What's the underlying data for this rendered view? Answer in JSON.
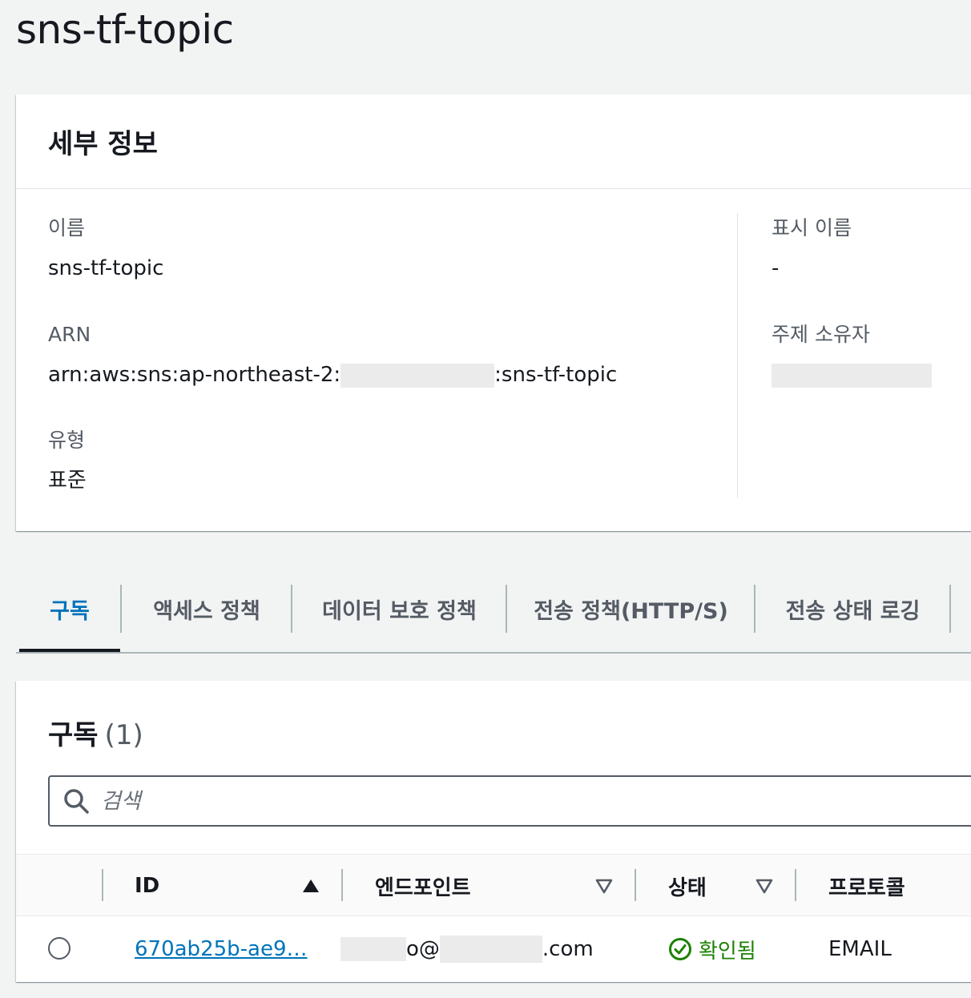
{
  "page": {
    "title": "sns-tf-topic"
  },
  "details": {
    "section_title": "세부 정보",
    "name_label": "이름",
    "name_value": "sns-tf-topic",
    "arn_label": "ARN",
    "arn_prefix": "arn:aws:sns:ap-northeast-2:",
    "arn_suffix": ":sns-tf-topic",
    "type_label": "유형",
    "type_value": "표준",
    "display_name_label": "표시 이름",
    "display_name_value": "-",
    "owner_label": "주제 소유자"
  },
  "tabs": [
    {
      "label": "구독",
      "active": true
    },
    {
      "label": "액세스 정책",
      "active": false
    },
    {
      "label": "데이터 보호 정책",
      "active": false
    },
    {
      "label": "전송 정책(HTTP/S)",
      "active": false
    },
    {
      "label": "전송 상태 로깅",
      "active": false
    }
  ],
  "subscriptions": {
    "title": "구독",
    "count": "(1)",
    "search_placeholder": "검색",
    "columns": [
      "ID",
      "엔드포인트",
      "상태",
      "프로토콜"
    ],
    "rows": [
      {
        "id": "670ab25b-ae9…",
        "endpoint_visible_start": "o@",
        "endpoint_visible_end": ".com",
        "status": "확인됨",
        "protocol": "EMAIL"
      }
    ]
  },
  "colors": {
    "link": "#0073bb",
    "success": "#1d8102",
    "background": "#f2f3f3"
  }
}
